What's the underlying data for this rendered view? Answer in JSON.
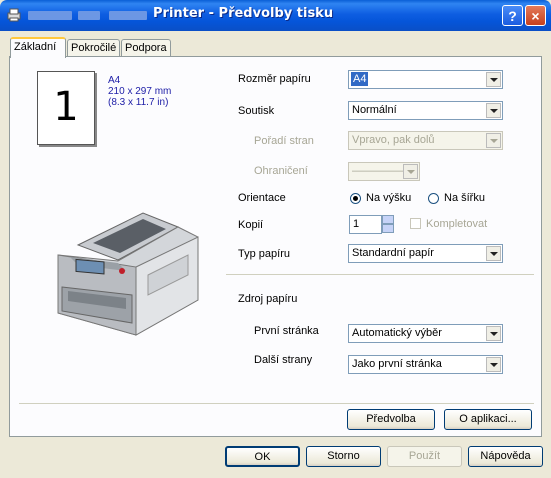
{
  "window": {
    "title": "Printer - Předvolby tisku",
    "help_glyph": "?",
    "close_glyph": "×"
  },
  "tabs": [
    {
      "label": "Základní",
      "active": true
    },
    {
      "label": "Pokročilé",
      "active": false
    },
    {
      "label": "Podpora",
      "active": false
    }
  ],
  "paper_preview": {
    "number": "1",
    "size": "A4",
    "mm": "210 x 297 mm",
    "inches": "(8.3 x 11.7 in)"
  },
  "settings": {
    "paper_size": {
      "label": "Rozměr papíru",
      "value": "A4"
    },
    "print_quality": {
      "label": "Soutisk",
      "value": "Normální"
    },
    "page_order": {
      "label": "Pořadí stran",
      "value": "Vpravo, pak dolů"
    },
    "border": {
      "label": "Ohraničení",
      "value": "——————"
    },
    "orientation": {
      "label": "Orientace",
      "portrait": "Na výšku",
      "landscape": "Na šířku",
      "selected": "portrait"
    },
    "copies": {
      "label": "Kopií",
      "value": "1",
      "collate": "Kompletovat"
    },
    "media_type": {
      "label": "Typ papíru",
      "value": "Standardní papír"
    }
  },
  "paper_source": {
    "heading": "Zdroj papíru",
    "first_page": {
      "label": "První stránka",
      "value": "Automatický výběr"
    },
    "other_pages": {
      "label": "Další strany",
      "value": "Jako první stránka"
    }
  },
  "panel_buttons": {
    "default": "Předvolba",
    "about": "O aplikaci..."
  },
  "dialog_buttons": {
    "ok": "OK",
    "cancel": "Storno",
    "apply": "Použít",
    "help": "Nápověda"
  },
  "colors": {
    "title_bar": "#0555d9",
    "paper_info_text": "#2020a8",
    "selection": "#316ac5"
  }
}
